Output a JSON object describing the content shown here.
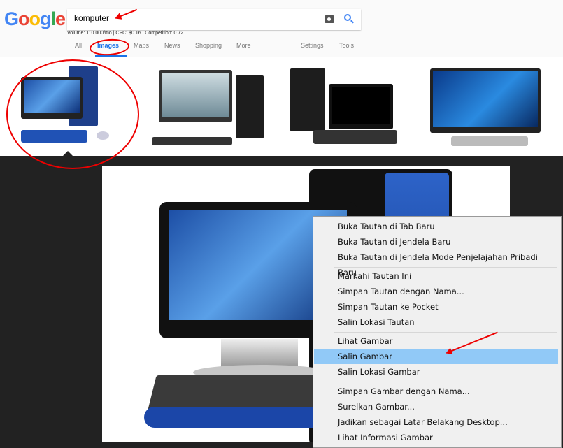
{
  "google": {
    "logo_text": "Google",
    "query": "komputer",
    "stats": "Volume: 110.000/mo | CPC: $0.16 | Competition: 0.72",
    "tabs": [
      "All",
      "Images",
      "Maps",
      "News",
      "Shopping",
      "More"
    ],
    "active_tab": "Images",
    "settings": "Settings",
    "tools": "Tools",
    "accent": "#1a73e8"
  },
  "context_menu": {
    "items": [
      "Buka Tautan di Tab Baru",
      "Buka Tautan di Jendela Baru",
      "Buka Tautan di Jendela Mode Penjelajahan Pribadi Baru",
      "Markahi Tautan Ini",
      "Simpan Tautan dengan Nama...",
      "Simpan Tautan ke Pocket",
      "Salin Lokasi Tautan",
      "Lihat Gambar",
      "Salin Gambar",
      "Salin Lokasi Gambar",
      "Simpan Gambar dengan Nama...",
      "Surelkan Gambar...",
      "Jadikan sebagai Latar Belakang Desktop...",
      "Lihat Informasi Gambar"
    ],
    "highlighted": "Salin Gambar",
    "highlight_color": "#91c9f7"
  },
  "annotation_color": "#e00000"
}
